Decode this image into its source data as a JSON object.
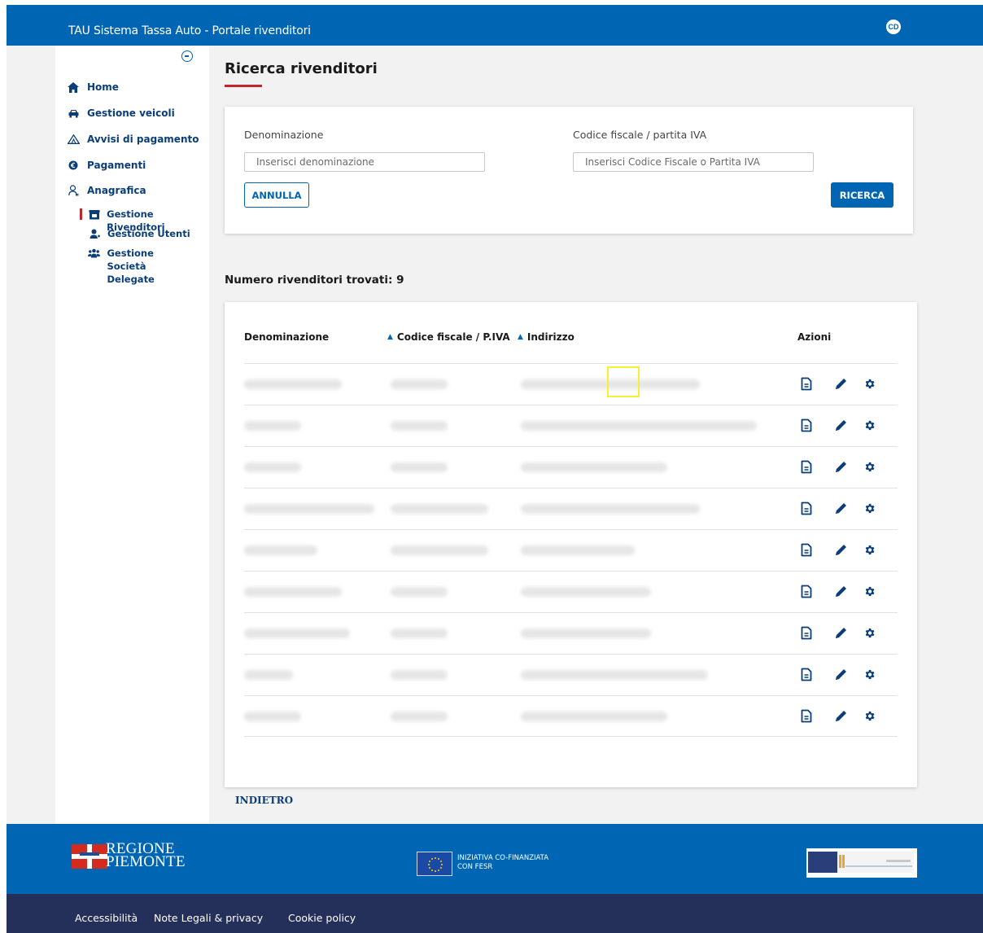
{
  "header": {
    "app_title": "TAU Sistema Tassa Auto - Portale rivenditori",
    "user_initials": "CD"
  },
  "sidebar": {
    "items": [
      {
        "label": "Home",
        "icon": "home-icon"
      },
      {
        "label": "Gestione veicoli",
        "icon": "car-icon"
      },
      {
        "label": "Avvisi di pagamento",
        "icon": "warning-icon"
      },
      {
        "label": "Pagamenti",
        "icon": "euro-icon"
      },
      {
        "label": "Anagrafica",
        "icon": "user-icon"
      }
    ],
    "sub_items": [
      {
        "label": "Gestione Rivenditori",
        "icon": "store-icon",
        "active": true
      },
      {
        "label": "Gestione Utenti",
        "icon": "user-add-icon",
        "active": false
      },
      {
        "label": "Gestione Società Delegate",
        "icon": "group-icon",
        "active": false
      }
    ]
  },
  "page": {
    "title": "Ricerca rivenditori"
  },
  "search": {
    "denominazione_label": "Denominazione",
    "denominazione_placeholder": "Inserisci denominazione",
    "codice_label": "Codice fiscale / partita IVA",
    "codice_placeholder": "Inserisci Codice Fiscale o Partita IVA",
    "annulla_label": "ANNULLA",
    "ricerca_label": "RICERCA"
  },
  "results": {
    "count_label": "Numero rivenditori trovati: 9",
    "columns": {
      "denominazione": "Denominazione",
      "codice": "Codice fiscale / P.IVA",
      "indirizzo": "Indirizzo",
      "azioni": "Azioni"
    },
    "rows_note_hidden": 9
  },
  "nav": {
    "back_label": "INDIETRO"
  },
  "footer": {
    "region_logo_line1": "REGIONE",
    "region_logo_line2": "PIEMONTE",
    "eu_line1": "INIZIATIVA CO-FINANZIATA",
    "eu_line2": "CON FESR",
    "links": [
      "Accessibilità",
      "Note Legali & privacy",
      "Cookie policy"
    ]
  },
  "colors": {
    "primary": "#0066b3",
    "accent_red": "#c0272d",
    "footer_dark": "#25305a",
    "highlight": "#f5f034"
  }
}
